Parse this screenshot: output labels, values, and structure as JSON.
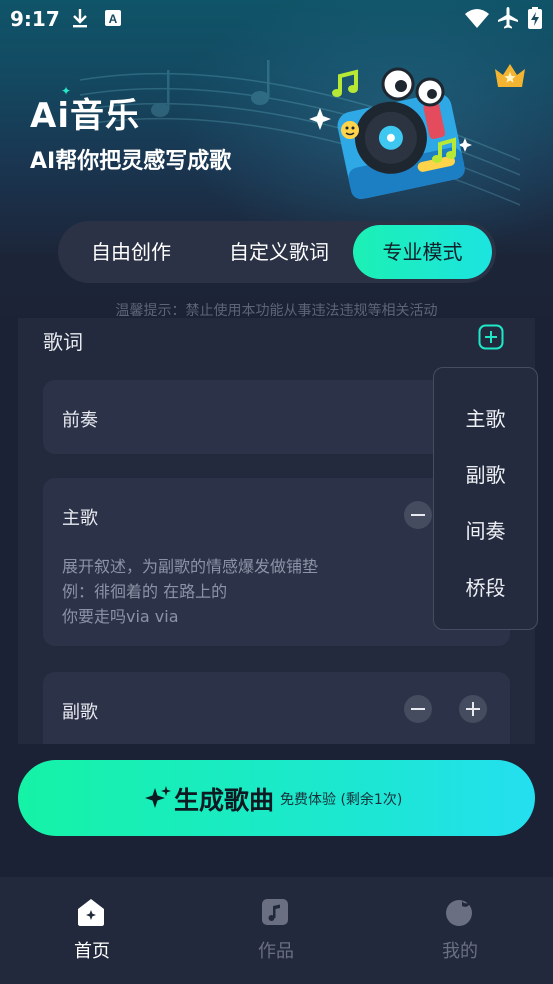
{
  "status_bar": {
    "time": "9:17",
    "left_icons": [
      "download-icon",
      "a-box-icon"
    ],
    "right_icons": [
      "wifi-icon",
      "airplane-icon",
      "battery-charging-icon"
    ]
  },
  "header": {
    "title": "Ai音乐",
    "subtitle": "AI帮你把灵感写成歌",
    "vip_icon": "crown-icon",
    "illustration": "record-player-mascot-illustration"
  },
  "tabs": [
    {
      "label": "自由创作",
      "active": false
    },
    {
      "label": "自定义歌词",
      "active": false
    },
    {
      "label": "专业模式",
      "active": true
    }
  ],
  "notice": "温馨提示：禁止使用本功能从事违法违规等相关活动",
  "lyrics": {
    "title": "歌词",
    "sections": [
      {
        "label": "前奏",
        "text": ""
      },
      {
        "label": "主歌",
        "text": "展开叙述，为副歌的情感爆发做铺垫\n例：徘徊着的 在路上的\n你要走吗via via"
      },
      {
        "label": "副歌",
        "text": ""
      }
    ]
  },
  "dropdown": {
    "items": [
      "主歌",
      "副歌",
      "间奏",
      "桥段"
    ]
  },
  "generate": {
    "label": "生成歌曲",
    "sub_label": "免费体验 (剩余1次)"
  },
  "bottom_nav": [
    {
      "label": "首页",
      "icon": "home-icon",
      "active": true
    },
    {
      "label": "作品",
      "icon": "music-note-icon",
      "active": false
    },
    {
      "label": "我的",
      "icon": "profile-icon",
      "active": false
    }
  ],
  "colors": {
    "accent": "#1cf0b4",
    "background": "#1c2236",
    "panel": "#232a3e",
    "card": "#2c3348",
    "inactive_text": "#6a7082"
  }
}
